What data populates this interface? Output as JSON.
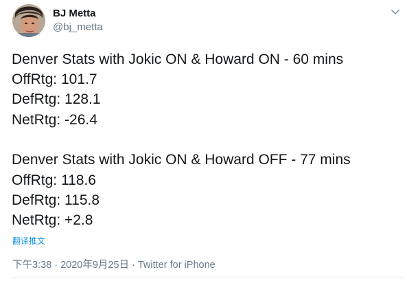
{
  "author": {
    "display_name": "BJ Metta",
    "handle": "@bj_metta"
  },
  "icons": {
    "avatar": "user-avatar-photo",
    "caret": "chevron-down-icon"
  },
  "tweet": {
    "lines": [
      "Denver Stats with Jokic ON & Howard ON - 60 mins",
      "OffRtg: 101.7",
      "DefRtg: 128.1",
      "NetRtg: -26.4",
      "",
      "Denver Stats with Jokic ON & Howard OFF - 77 mins",
      "OffRtg: 118.6",
      "DefRtg: 115.8",
      "NetRtg: +2.8"
    ],
    "translate_label": "翻译推文",
    "time": "下午3:38",
    "separator": "·",
    "date": "2020年9月25日",
    "source": "Twitter for iPhone"
  },
  "colors": {
    "text": "#14171a",
    "secondary": "#657786",
    "link": "#1b95e0",
    "divider": "#e6ecf0"
  }
}
